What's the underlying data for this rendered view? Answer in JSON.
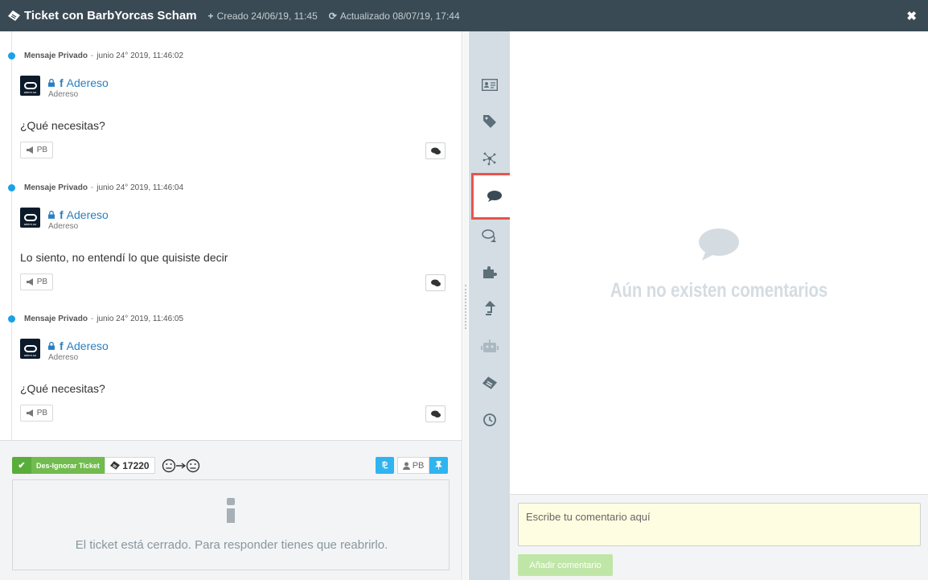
{
  "header": {
    "title": "Ticket con BarbYorcas Scham",
    "created": "Creado 24/06/19, 11:45",
    "updated": "Actualizado 08/07/19, 17:44"
  },
  "messages": [
    {
      "type_label": "Mensaje Privado",
      "datetime": "junio 24° 2019, 11:46:02",
      "author": "Adereso",
      "author_sub": "Adereso",
      "avatar_text": "adere.so",
      "text": "¿Qué necesitas?",
      "tag": "PB"
    },
    {
      "type_label": "Mensaje Privado",
      "datetime": "junio 24° 2019, 11:46:04",
      "author": "Adereso",
      "author_sub": "Adereso",
      "avatar_text": "adere.so",
      "text": "Lo siento, no entendí lo que quisiste decir",
      "tag": "PB"
    },
    {
      "type_label": "Mensaje Privado",
      "datetime": "junio 24° 2019, 11:46:05",
      "author": "Adereso",
      "author_sub": "Adereso",
      "avatar_text": "adere.so",
      "text": "¿Qué necesitas?",
      "tag": "PB"
    }
  ],
  "bottom_bar": {
    "ignore_label": "Des-Ignorar Ticket",
    "ticket_number": "17220",
    "pb_label": "PB",
    "closed_message": "El ticket está cerrado. Para responder tienes que reabrirlo."
  },
  "sidebar_icons": [
    "contact-card-icon",
    "tag-icon",
    "network-icon",
    "comment-icon",
    "conversations-icon",
    "puzzle-icon",
    "upload-icon",
    "robot-icon",
    "ticket-icon",
    "clock-icon"
  ],
  "comments": {
    "empty_text": "Aún no existen comentarios",
    "placeholder": "Escribe tu comentario aquí",
    "add_button": "Añadir comentario"
  },
  "colors": {
    "header_bg": "#3a4a54",
    "accent_blue": "#1aa1e6",
    "green": "#72bb4e",
    "highlight": "#e8544b"
  }
}
